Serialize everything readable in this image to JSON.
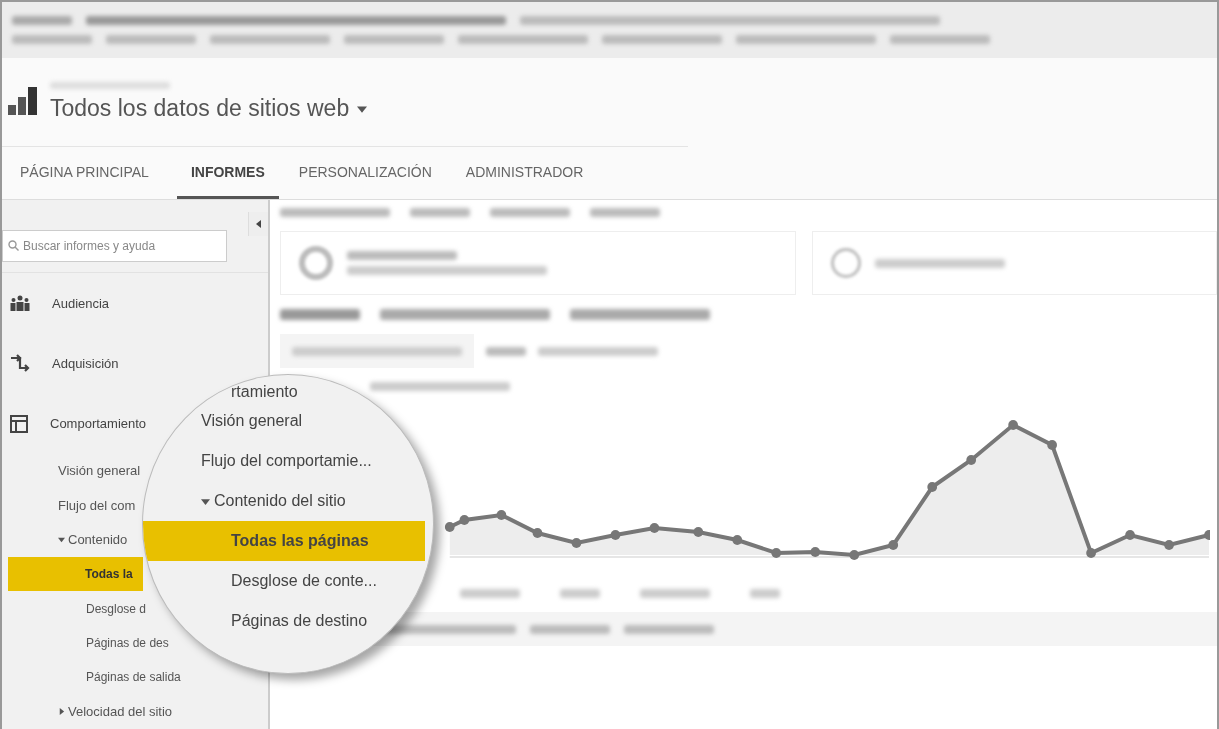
{
  "header": {
    "title": "Todos los datos de sitios web"
  },
  "nav": {
    "tabs": [
      {
        "label": "PÁGINA PRINCIPAL",
        "selected": false
      },
      {
        "label": "INFORMES",
        "selected": true
      },
      {
        "label": "PERSONALIZACIÓN",
        "selected": false
      },
      {
        "label": "ADMINISTRADOR",
        "selected": false
      }
    ]
  },
  "sidebar": {
    "search": {
      "placeholder": "Buscar informes y ayuda"
    },
    "sections": [
      {
        "label": "Audiencia",
        "kind": "audience"
      },
      {
        "label": "Adquisición",
        "kind": "acquisition"
      },
      {
        "label": "Comportamiento",
        "kind": "behavior"
      }
    ],
    "items": [
      {
        "label": "Visión general",
        "selected": false
      },
      {
        "label": "Flujo del com",
        "selected": false
      },
      {
        "label": "Contenido",
        "selected": false,
        "expanded": true,
        "children": [
          {
            "label": "Todas la",
            "selected": true
          },
          {
            "label": "Desglose d",
            "selected": false
          },
          {
            "label": "Páginas de des",
            "selected": false
          },
          {
            "label": "Páginas de salida",
            "selected": false
          }
        ]
      },
      {
        "label": "Velocidad del sitio",
        "selected": false,
        "expanded": false
      }
    ]
  },
  "magnifier": {
    "items": [
      {
        "label": "rtamiento",
        "selected": false
      },
      {
        "label": "Visión general",
        "selected": false
      },
      {
        "label": "Flujo del comportamie...",
        "selected": false
      },
      {
        "label": "Contenido del sitio",
        "selected": false,
        "expanded": true,
        "children": [
          {
            "label": "Todas las páginas",
            "selected": true
          },
          {
            "label": "Desglose de conte...",
            "selected": false
          },
          {
            "label": "Páginas de destino",
            "selected": false
          }
        ]
      }
    ]
  }
}
